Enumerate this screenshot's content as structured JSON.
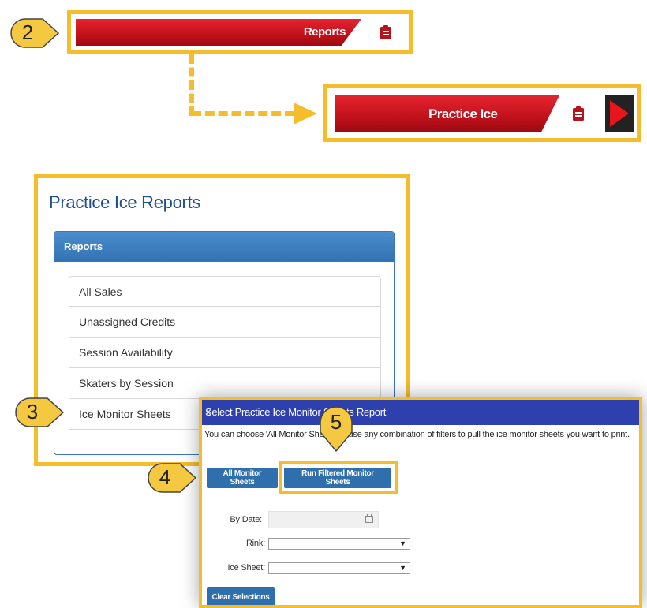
{
  "colors": {
    "highlight": "#f5bd2c",
    "brand_red": "#c4121c",
    "panel_blue": "#3473b3",
    "dialog_title": "#2e3fae"
  },
  "callouts": {
    "step2": "2",
    "step3": "3",
    "step4": "4",
    "step5": "5"
  },
  "nav": {
    "reports": {
      "label": "Reports",
      "icon": "clipboard-icon"
    },
    "practice_ice": {
      "label": "Practice Ice",
      "icon": "clipboard-icon",
      "expand_icon": "triangle-right-icon"
    }
  },
  "panel": {
    "title": "Practice Ice Reports",
    "reports_header": "Reports",
    "items": [
      {
        "label": "All Sales"
      },
      {
        "label": "Unassigned Credits"
      },
      {
        "label": "Session Availability"
      },
      {
        "label": "Skaters by Session"
      },
      {
        "label": "Ice Monitor Sheets"
      }
    ]
  },
  "dialog": {
    "title": "Select Practice Ice Monitor Sheets Report",
    "close": "×",
    "description": "You can choose 'All Monitor Sheets' or use any combination of filters to pull the ice monitor sheets you want to print.",
    "all_button": "All Monitor Sheets",
    "run_button": "Run Filtered Monitor Sheets",
    "by_date_label": "By Date:",
    "rink_label": "Rink:",
    "ice_sheet_label": "Ice Sheet:",
    "rink_value": "",
    "ice_sheet_value": "",
    "clear_button": "Clear Selections"
  }
}
